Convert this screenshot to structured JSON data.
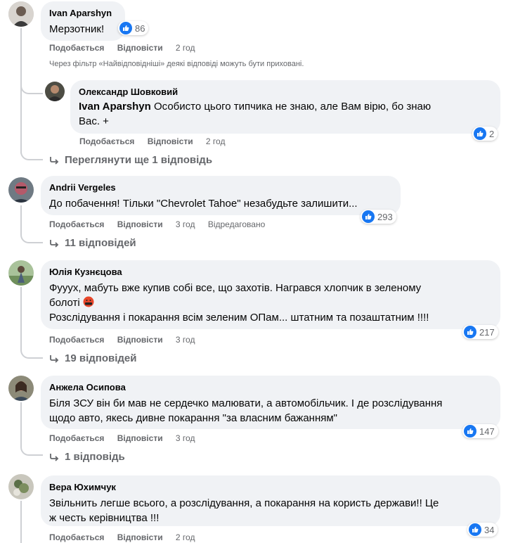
{
  "comments": [
    {
      "author": "Ivan Aparshyn",
      "text": "Мерзотник!",
      "likes": "86",
      "actions": {
        "like": "Подобається",
        "reply": "Відповісти",
        "time": "2 год"
      },
      "filter_note": "Через фільтр «Найвідповідніші» деякі відповіді можуть бути приховані.",
      "reply": {
        "author": "Олександр Шовковий",
        "mention": "Ivan Aparshyn",
        "text_line1": " Особисто цього типчика не знаю, але Вам вірю, бо знаю",
        "text_line2": "Вас. +",
        "likes": "2",
        "actions": {
          "like": "Подобається",
          "reply": "Відповісти",
          "time": "2 год"
        }
      },
      "more_replies": "Переглянути ще 1 відповідь"
    },
    {
      "author": "Andrii Vergeles",
      "text": "До побачення! Тільки \"Chevrolet Tahoe\" незабудьте залишити...",
      "likes": "293",
      "actions": {
        "like": "Подобається",
        "reply": "Відповісти",
        "time": "3 год",
        "edited": "Відредаговано"
      },
      "more_replies": "11 відповідей"
    },
    {
      "author": "Юлія Кузнєцова",
      "text_line1": "Фуууx, мабуть вже купив собі все, що захотів. Награвся хлопчик в зеленому",
      "text_line2": "болоті",
      "emoji_name": "face-with-symbols-icon",
      "text_line3": "Розслідування і покарання всім зеленим ОПам... штатним та позаштатним !!!!",
      "likes": "217",
      "actions": {
        "like": "Подобається",
        "reply": "Відповісти",
        "time": "3 год"
      },
      "more_replies": "19 відповідей"
    },
    {
      "author": "Анжела Осипова",
      "text_line1": "Біля ЗСУ він би мав не сердечко малювати, а автомобільчик. І де розслідування",
      "text_line2": "щодо авто, якесь дивне покарання \"за власним бажанням\"",
      "likes": "147",
      "actions": {
        "like": "Подобається",
        "reply": "Відповісти",
        "time": "3 год"
      },
      "more_replies": "1 відповідь"
    },
    {
      "author": "Вера Юхимчук",
      "text_line1": "Звільнить легше всього, а розслідування, а покарання на користь держави!! Це",
      "text_line2": "ж честь керівництва !!!",
      "likes": "34",
      "actions": {
        "like": "Подобається",
        "reply": "Відповісти",
        "time": "2 год"
      }
    }
  ],
  "colors": {
    "bubble": "#f0f2f5",
    "like": "#1877f2",
    "muted": "#65676b",
    "text": "#050505"
  }
}
